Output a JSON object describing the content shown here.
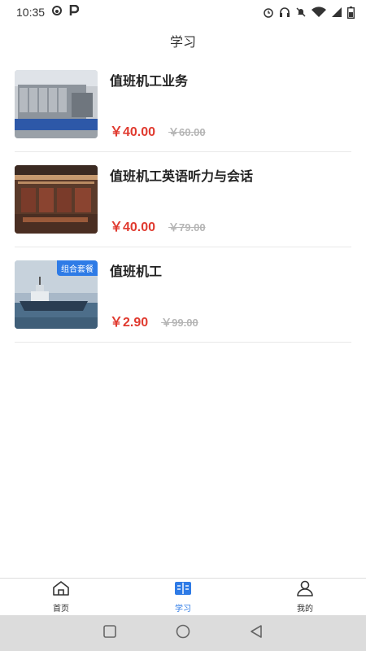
{
  "status_bar": {
    "time": "10:35",
    "left_icons": [
      "weibo-icon",
      "parking-icon"
    ],
    "right_icons": [
      "alarm-icon",
      "headset-icon",
      "mute-icon",
      "wifi-icon",
      "signal-icon",
      "battery-icon"
    ]
  },
  "header": {
    "title": "学习"
  },
  "courses": [
    {
      "name": "值班机工业务",
      "price": "￥40.00",
      "original_price": "￥60.00",
      "badge": ""
    },
    {
      "name": "值班机工英语听力与会话",
      "price": "￥40.00",
      "original_price": "￥79.00",
      "badge": ""
    },
    {
      "name": "值班机工",
      "price": "￥2.90",
      "original_price": "￥99.00",
      "badge": "组合套餐"
    }
  ],
  "tabs": [
    {
      "label": "首页",
      "icon": "home-icon",
      "active": false
    },
    {
      "label": "学习",
      "icon": "book-icon",
      "active": true
    },
    {
      "label": "我的",
      "icon": "user-icon",
      "active": false
    }
  ],
  "nav": {
    "buttons": [
      "recents-button",
      "home-button",
      "back-button"
    ]
  },
  "colors": {
    "accent": "#2e7be6",
    "price": "#e03a2f",
    "strike": "#b5b5b5"
  }
}
